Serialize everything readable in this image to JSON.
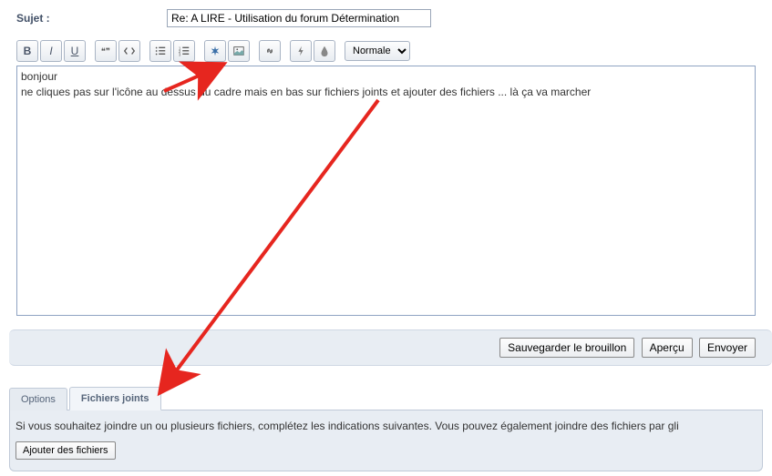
{
  "subject": {
    "label": "Sujet :",
    "value": "Re: A LIRE - Utilisation du forum Détermination"
  },
  "toolbar": {
    "bold": "B",
    "italic": "I",
    "underline": "U",
    "quote": "❝❞",
    "code": "</>",
    "ul": "list",
    "ol": "list-ol",
    "burst": "*",
    "image": "img",
    "link": "link",
    "flash": "flash",
    "color": "color",
    "font_select": "Normale"
  },
  "editor": {
    "content": "bonjour\nne cliques pas sur l'icône au dessus du cadre mais en bas sur fichiers joints et ajouter des fichiers ... là ça va marcher"
  },
  "actions": {
    "save_draft": "Sauvegarder le brouillon",
    "preview": "Aperçu",
    "submit": "Envoyer"
  },
  "tabs": {
    "options": "Options",
    "attachments": "Fichiers joints"
  },
  "panel": {
    "instruction": "Si vous souhaitez joindre un ou plusieurs fichiers, complétez les indications suivantes. Vous pouvez également joindre des fichiers par gli",
    "add_files": "Ajouter des fichiers"
  }
}
